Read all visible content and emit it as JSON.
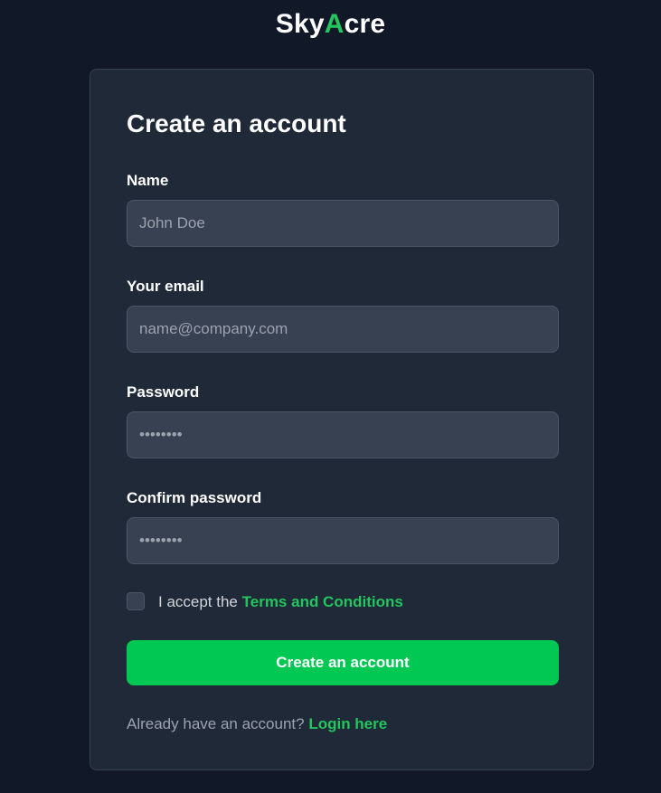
{
  "logo": {
    "part1": "Sky",
    "accent": "A",
    "part2": "cre"
  },
  "form": {
    "title": "Create an account",
    "fields": [
      {
        "label": "Name",
        "placeholder": "John Doe",
        "value": ""
      },
      {
        "label": "Your email",
        "placeholder": "name@company.com",
        "value": ""
      },
      {
        "label": "Password",
        "placeholder": "••••••••",
        "value": ""
      },
      {
        "label": "Confirm password",
        "placeholder": "••••••••",
        "value": ""
      }
    ],
    "terms": {
      "checked": false,
      "prefix": "I accept the ",
      "link_text": "Terms and Conditions"
    },
    "submit_label": "Create an account",
    "login": {
      "prefix": "Already have an account? ",
      "link_text": "Login here"
    }
  },
  "colors": {
    "background": "#111827",
    "card": "#1f2937",
    "input": "#374151",
    "accent": "#22c55e",
    "button": "#00c853"
  }
}
